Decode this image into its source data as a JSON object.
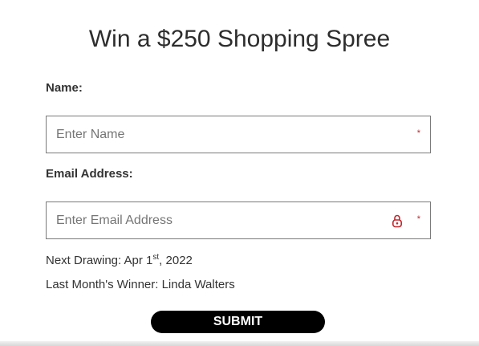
{
  "form": {
    "title": "Win a $250 Shopping Spree",
    "name_label": "Name:",
    "name_placeholder": "Enter Name",
    "email_label": "Email Address:",
    "email_placeholder": "Enter Email Address",
    "required_marker": "*",
    "submit_label": "SUBMIT"
  },
  "info": {
    "drawing_prefix": "Next Drawing: Apr 1",
    "drawing_suffix": "st",
    "drawing_year": ", 2022",
    "winner": "Last Month's Winner: Linda Walters"
  },
  "colors": {
    "required": "#c0272d",
    "lock_icon": "#c0272d",
    "submit_bg": "#000000",
    "border": "#7a7a7a"
  },
  "icons": {
    "email_field": "lock-icon"
  }
}
